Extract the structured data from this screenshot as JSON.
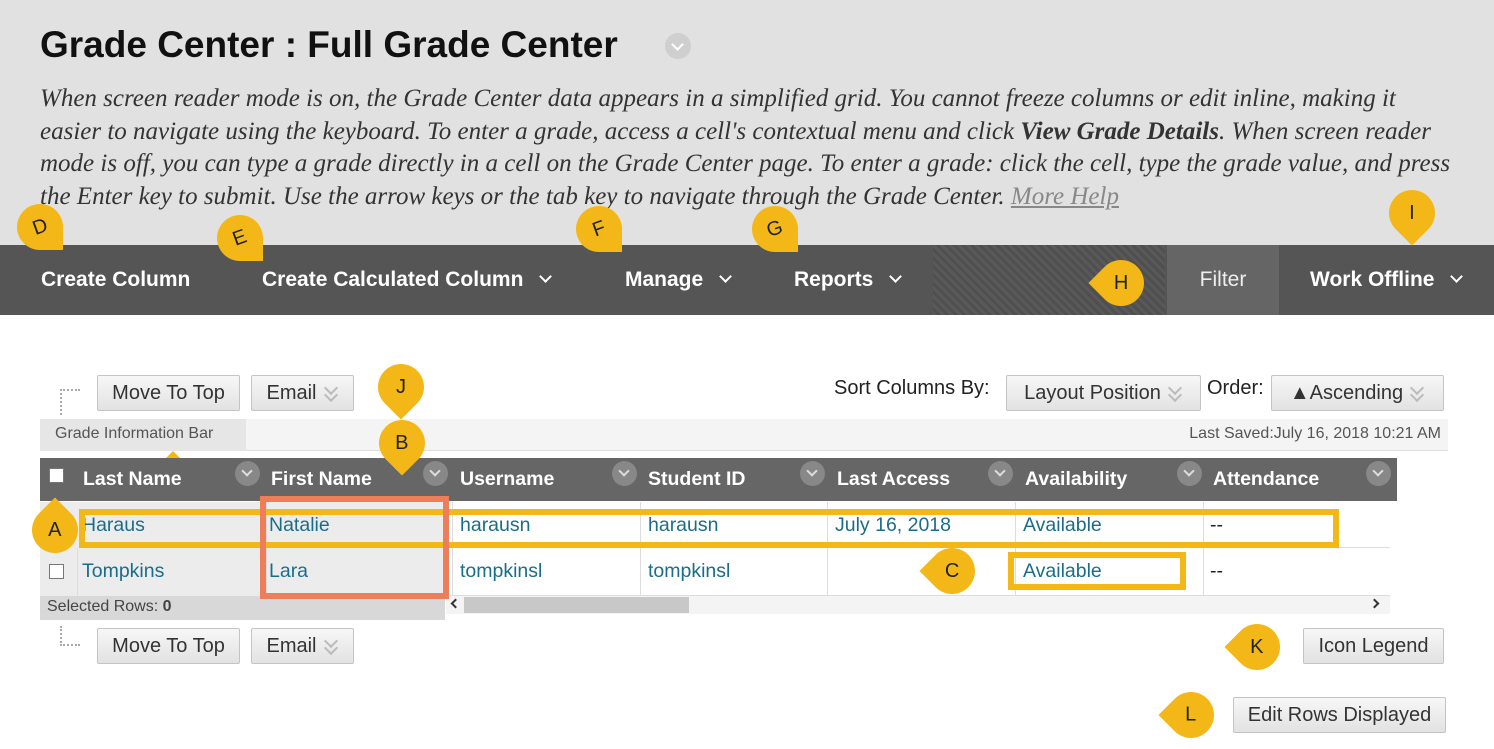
{
  "page": {
    "title": "Grade Center : Full Grade Center",
    "intro_part1": "When screen reader mode is on, the Grade Center data appears in a simplified grid. You cannot freeze columns or edit inline, making it easier to navigate using the keyboard. To enter a grade, access a cell's contextual menu and click ",
    "intro_bold": "View Grade Details",
    "intro_part2": ". When screen reader mode is off, you can type a grade directly in a cell on the Grade Center page. To enter a grade: click the cell, type the grade value, and press the Enter key to submit. Use the arrow keys or the tab key to navigate through the Grade Center. ",
    "intro_more": "More Help"
  },
  "navbar": {
    "create_column": "Create Column",
    "create_calculated_column": "Create Calculated Column",
    "manage": "Manage",
    "reports": "Reports",
    "filter": "Filter",
    "work_offline": "Work Offline"
  },
  "toolbar": {
    "move_to_top": "Move To Top",
    "email": "Email",
    "sort_label": "Sort Columns By:",
    "sort_value": "Layout Position",
    "order_label": "Order:",
    "order_value": "▲Ascending"
  },
  "info_bar": {
    "tab_label": "Grade Information Bar",
    "last_saved": "Last Saved:July 16, 2018 10:21 AM"
  },
  "table": {
    "columns": [
      "Last Name",
      "First Name",
      "Username",
      "Student ID",
      "Last Access",
      "Availability",
      "Attendance"
    ],
    "rows": [
      {
        "last_name": "Haraus",
        "first_name": "Natalie",
        "username": "harausn",
        "student_id": "harausn",
        "last_access": "July 16, 2018",
        "availability": "Available",
        "attendance": "--"
      },
      {
        "last_name": "Tompkins",
        "first_name": "Lara",
        "username": "tompkinsl",
        "student_id": "tompkinsl",
        "last_access": "",
        "availability": "Available",
        "attendance": "--"
      }
    ],
    "selected_rows_label": "Selected Rows:",
    "selected_rows_count": "0"
  },
  "bottom": {
    "move_to_top": "Move To Top",
    "email": "Email",
    "icon_legend": "Icon Legend",
    "edit_rows_displayed": "Edit Rows Displayed"
  },
  "markers": {
    "a": "A",
    "b": "B",
    "c": "C",
    "d": "D",
    "e": "E",
    "f": "F",
    "g": "G",
    "h": "H",
    "i": "I",
    "j": "J",
    "k": "K",
    "l": "L"
  },
  "colors": {
    "marker": "#f3b817",
    "highlight_orange": "#ee7d5a",
    "navbar": "#555555",
    "link": "#1a6d8a"
  }
}
